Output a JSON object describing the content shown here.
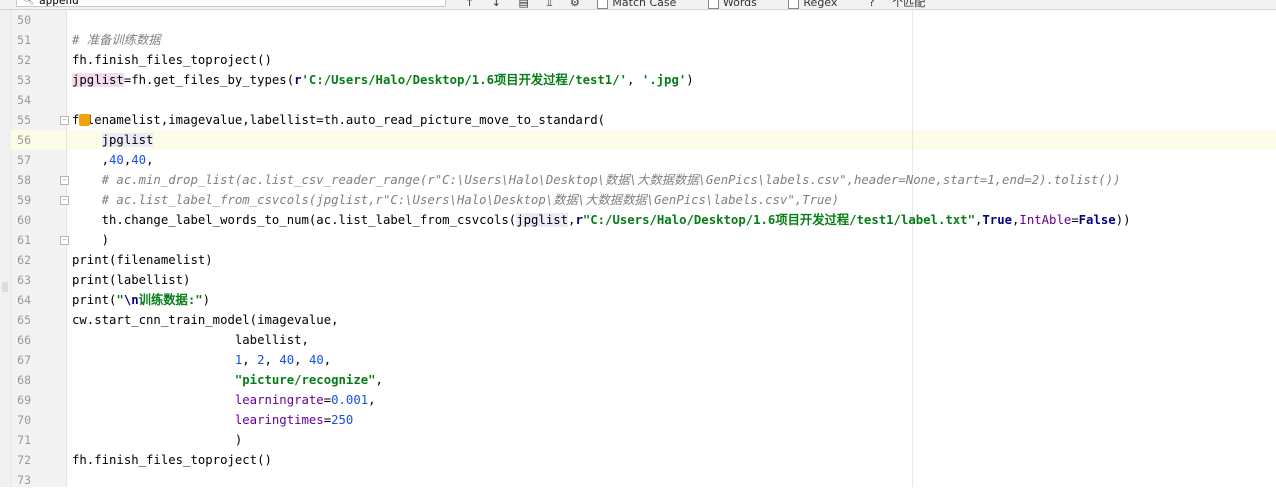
{
  "find_bar": {
    "search_value": "append",
    "match_case_label": "Match Case",
    "words_label": "Words",
    "regex_label": "Regex",
    "help_label": "?",
    "results_label": "个匹配"
  },
  "lines": [
    {
      "no": "50",
      "text": ""
    },
    {
      "no": "51",
      "text": "# 准备训练数据"
    },
    {
      "no": "52",
      "text": "fh.finish_files_toproject()"
    },
    {
      "no": "53",
      "text": "jpglist=fh.get_files_by_types(r'C:/Users/Halo/Desktop/1.6项目开发过程/test1/', '.jpg')"
    },
    {
      "no": "54",
      "text": ""
    },
    {
      "no": "55",
      "text": "filenamelist,imagevalue,labellist=th.auto_read_picture_move_to_standard("
    },
    {
      "no": "56",
      "text": "    jpglist"
    },
    {
      "no": "57",
      "text": "    ,40,40,"
    },
    {
      "no": "58",
      "text": "    # ac.min_drop_list(ac.list_csv_reader_range(r\"C:\\Users\\Halo\\Desktop\\数据\\大数据数据\\GenPics\\labels.csv\",header=None,start=1,end=2).tolist())"
    },
    {
      "no": "59",
      "text": "    # ac.list_label_from_csvcols(jpglist,r\"C:\\Users\\Halo\\Desktop\\数据\\大数据数据\\GenPics\\labels.csv\",True)"
    },
    {
      "no": "60",
      "text": "    th.change_label_words_to_num(ac.list_label_from_csvcols(jpglist,r\"C:/Users/Halo/Desktop/1.6项目开发过程/test1/label.txt\",True,IntAble=False))"
    },
    {
      "no": "61",
      "text": "    )"
    },
    {
      "no": "62",
      "text": "print(filenamelist)"
    },
    {
      "no": "63",
      "text": "print(labellist)"
    },
    {
      "no": "64",
      "text": "print(\"\\n训练数据:\")"
    },
    {
      "no": "65",
      "text": "cw.start_cnn_train_model(imagevalue,"
    },
    {
      "no": "66",
      "text": "                      labellist,"
    },
    {
      "no": "67",
      "text": "                      1, 2, 40, 40,"
    },
    {
      "no": "68",
      "text": "                      \"picture/recognize\","
    },
    {
      "no": "69",
      "text": "                      learningrate=0.001,"
    },
    {
      "no": "70",
      "text": "                      learingtimes=250"
    },
    {
      "no": "71",
      "text": "                      )"
    },
    {
      "no": "72",
      "text": "fh.finish_files_toproject()"
    },
    {
      "no": "73",
      "text": ""
    }
  ],
  "colors": {
    "comment": "#808080",
    "string": "#067d17",
    "number": "#1750eb",
    "keyword": "#000080",
    "kwarg": "#660099",
    "current_line": "#fdfce8"
  },
  "icons": [
    "search-icon",
    "lightbulb-icon",
    "fold-icon"
  ]
}
